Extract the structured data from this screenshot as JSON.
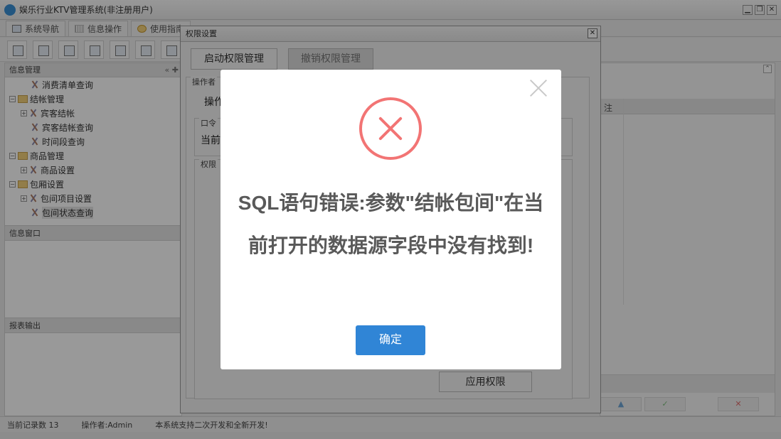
{
  "window": {
    "title": "娱乐行业KTV管理系统(非注册用户)",
    "controls": [
      "▁",
      "❐",
      "✕"
    ]
  },
  "nav_tabs": [
    {
      "label": "系统导航"
    },
    {
      "label": "信息操作"
    },
    {
      "label": "使用指南"
    }
  ],
  "left_panel": {
    "info_header": "信息管理",
    "tree": [
      {
        "label": "消费清单查询"
      },
      {
        "label": "结帐管理"
      },
      {
        "label": "宾客结帐"
      },
      {
        "label": "宾客结帐查询"
      },
      {
        "label": "时间段查询"
      },
      {
        "label": "商品管理"
      },
      {
        "label": "商品设置"
      },
      {
        "label": "包厢设置"
      },
      {
        "label": "包间项目设置"
      },
      {
        "label": "包间状态查询"
      }
    ],
    "info_window_header": "信息窗口",
    "report_header": "报表输出"
  },
  "right_panel": {
    "column_label": "注"
  },
  "status_bar": {
    "record_count": "当前记录数 13",
    "operator": "操作者:Admin",
    "note": "本系统支持二次开发和全新开发!"
  },
  "permission_dialog": {
    "title": "权限设置",
    "enable_button": "启动权限管理",
    "revoke_button": "撤销权限管理",
    "operator_group": "操作者",
    "operator_label": "操作",
    "password_group": "口令",
    "current_label": "当前",
    "permission_group": "权限",
    "apply_button": "应用权限"
  },
  "error_modal": {
    "message": "SQL语句错误:参数\"结帐包间\"在当前打开的数据源字段中没有找到!",
    "confirm_button": "确定",
    "accent_color": "#3085d6",
    "error_color": "#f27474"
  }
}
